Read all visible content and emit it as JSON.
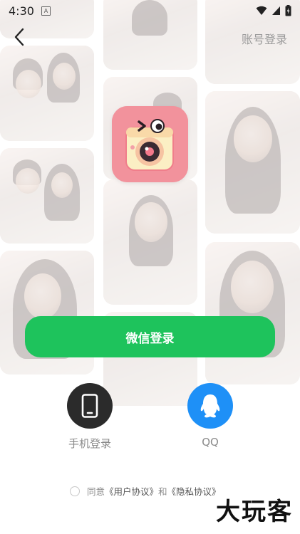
{
  "status_bar": {
    "time": "4:30",
    "notification_icon": "A"
  },
  "header": {
    "back_icon": "chevron-left-icon",
    "account_login_label": "账号登录"
  },
  "buttons": {
    "wechat_login_label": "微信登录"
  },
  "alternate_logins": {
    "phone_label": "手机登录",
    "qq_label": "QQ"
  },
  "agreement": {
    "prefix": "同意",
    "user_agreement": "《用户协议》",
    "conjunction": "和",
    "privacy_agreement": "《隐私协议》"
  },
  "watermark": {
    "text": "大玩客"
  },
  "colors": {
    "wechat_green": "#1ec35c",
    "qq_blue": "#1e90f7",
    "phone_dark": "#2b2b2b",
    "logo_pink": "#f2929c"
  }
}
